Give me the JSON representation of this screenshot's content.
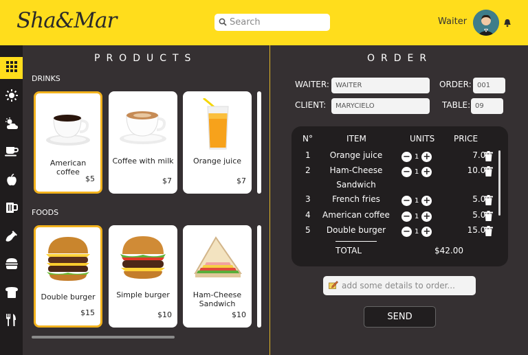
{
  "header": {
    "logo": "Sha&Mar",
    "search_placeholder": "Search",
    "user_role": "Waiter"
  },
  "sidebar": {
    "items": [
      {
        "icon": "grid-icon",
        "active": true
      },
      {
        "icon": "sun-icon"
      },
      {
        "icon": "cloud-sun-icon"
      },
      {
        "icon": "coffee-cup-icon"
      },
      {
        "icon": "apple-icon"
      },
      {
        "icon": "beer-mug-icon"
      },
      {
        "icon": "wine-bottle-icon"
      },
      {
        "icon": "burger-icon"
      },
      {
        "icon": "bread-icon"
      },
      {
        "icon": "utensils-icon"
      }
    ]
  },
  "products": {
    "title": "PRODUCTS",
    "drinks_label": "DRINKS",
    "foods_label": "FOODS",
    "drinks": [
      {
        "name": "American coffee",
        "price": "$5",
        "selected": true
      },
      {
        "name": "Coffee with milk",
        "price": "$7"
      },
      {
        "name": "Orange juice",
        "price": "$7"
      }
    ],
    "foods": [
      {
        "name": "Double burger",
        "price": "$15",
        "selected": true
      },
      {
        "name": "Simple burger",
        "price": "$10"
      },
      {
        "name": "Ham-Cheese Sandwich",
        "price": "$10"
      }
    ]
  },
  "order": {
    "title": "ORDER",
    "waiter_label": "WAITER:",
    "waiter_value": "WAITER",
    "order_label": "ORDER:",
    "order_value": "001",
    "client_label": "CLIENT:",
    "client_value": "MARYCIELO",
    "table_label": "TABLE:",
    "table_value": "09",
    "columns": [
      "N°",
      "ITEM",
      "UNITS",
      "PRICE"
    ],
    "items": [
      {
        "n": "1",
        "item": "Orange juice",
        "units": "1",
        "price": "7.00"
      },
      {
        "n": "2",
        "item": "Ham-Cheese Sandwich",
        "units": "1",
        "price": "10.00"
      },
      {
        "n": "3",
        "item": "French fries",
        "units": "1",
        "price": "5.00"
      },
      {
        "n": "4",
        "item": "American coffee",
        "units": "1",
        "price": "5.00"
      },
      {
        "n": "5",
        "item": "Double burger",
        "units": "1",
        "price": "15.00"
      }
    ],
    "total_label": "TOTAL",
    "total_value": "$42.00",
    "details_placeholder": "add some details to order...",
    "send_label": "SEND"
  },
  "colors": {
    "accent": "#ffdd1c",
    "background": "#353032",
    "panel_dark": "#211e1f",
    "card_border": "#f2b21d"
  }
}
